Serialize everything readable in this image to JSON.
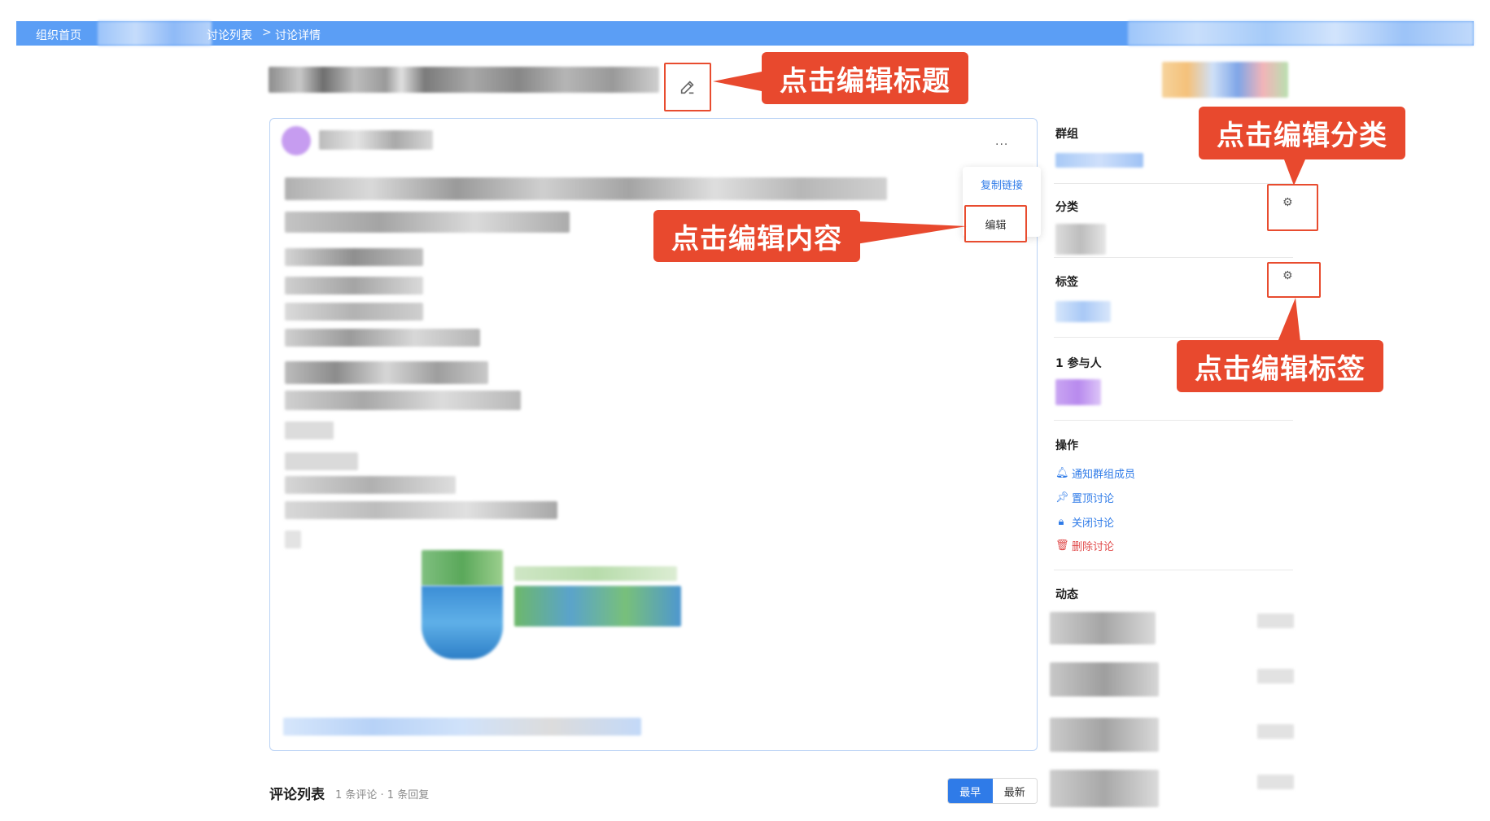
{
  "breadcrumb": {
    "home": "组织首页",
    "list": "讨论列表",
    "separator": ">",
    "detail": "讨论详情"
  },
  "post": {
    "more": "...",
    "menu": {
      "copy_link": "复制链接",
      "edit": "编辑"
    }
  },
  "sidebar": {
    "group_label": "群组",
    "category_label": "分类",
    "tags_label": "标签",
    "participants_label": "1 参与人",
    "actions_label": "操作",
    "actions": [
      {
        "label": "通知群组成员",
        "icon": "bell-icon"
      },
      {
        "label": "置顶讨论",
        "icon": "pin-icon"
      },
      {
        "label": "关闭讨论",
        "icon": "lock-icon"
      },
      {
        "label": "删除讨论",
        "icon": "trash-icon"
      }
    ],
    "activity_label": "动态"
  },
  "callouts": {
    "edit_title": "点击编辑标题",
    "edit_content": "点击编辑内容",
    "edit_category": "点击编辑分类",
    "edit_tags": "点击编辑标签"
  },
  "comments": {
    "title": "评论列表",
    "meta": "1 条评论 · 1 条回复",
    "sort_earliest": "最早",
    "sort_latest": "最新"
  },
  "colors": {
    "accent": "#2f7be8",
    "topbar": "#5b9ef5",
    "callout": "#e8492e",
    "danger": "#e04a4a"
  }
}
